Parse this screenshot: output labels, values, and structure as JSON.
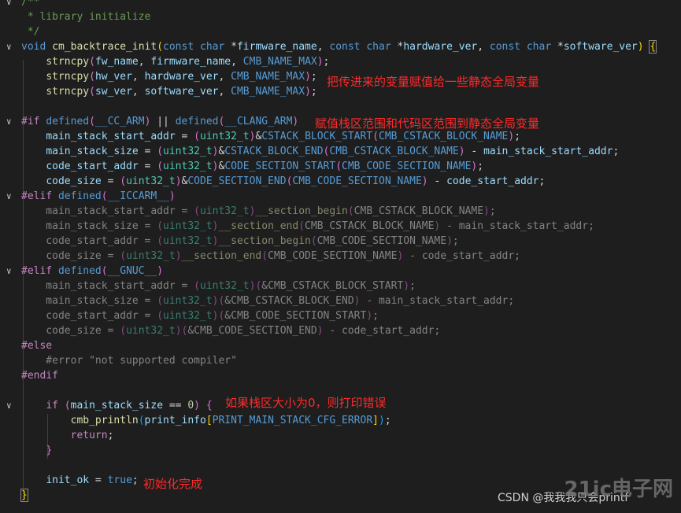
{
  "lines": [
    {
      "fold": "chevron-down",
      "segments": [
        {
          "c": "cm",
          "t": "/**"
        }
      ]
    },
    {
      "fold": "",
      "segments": [
        {
          "c": "cm",
          "t": " * library initialize"
        }
      ]
    },
    {
      "fold": "",
      "segments": [
        {
          "c": "cm",
          "t": " */"
        }
      ]
    },
    {
      "fold": "chevron-down",
      "segments": [
        {
          "c": "kw",
          "t": "void"
        },
        {
          "c": "",
          "t": " "
        },
        {
          "c": "fn",
          "t": "cm_backtrace_init"
        },
        {
          "c": "brace-y",
          "t": "("
        },
        {
          "c": "kw",
          "t": "const"
        },
        {
          "c": "",
          "t": " "
        },
        {
          "c": "kw",
          "t": "char"
        },
        {
          "c": "",
          "t": " *"
        },
        {
          "c": "var",
          "t": "firmware_name"
        },
        {
          "c": "",
          "t": ", "
        },
        {
          "c": "kw",
          "t": "const"
        },
        {
          "c": "",
          "t": " "
        },
        {
          "c": "kw",
          "t": "char"
        },
        {
          "c": "",
          "t": " *"
        },
        {
          "c": "var",
          "t": "hardware_ver"
        },
        {
          "c": "",
          "t": ", "
        },
        {
          "c": "kw",
          "t": "const"
        },
        {
          "c": "",
          "t": " "
        },
        {
          "c": "kw",
          "t": "char"
        },
        {
          "c": "",
          "t": " *"
        },
        {
          "c": "var",
          "t": "software_ver"
        },
        {
          "c": "brace-y",
          "t": ")"
        },
        {
          "c": "",
          "t": " "
        },
        {
          "c": "brace-y brace-hl",
          "t": "{"
        }
      ]
    },
    {
      "fold": "",
      "segments": [
        {
          "c": "",
          "t": "    "
        },
        {
          "c": "fn",
          "t": "strncpy"
        },
        {
          "c": "brace-p",
          "t": "("
        },
        {
          "c": "var",
          "t": "fw_name"
        },
        {
          "c": "",
          "t": ", "
        },
        {
          "c": "var",
          "t": "firmware_name"
        },
        {
          "c": "",
          "t": ", "
        },
        {
          "c": "mac",
          "t": "CMB_NAME_MAX"
        },
        {
          "c": "brace-p",
          "t": ")"
        },
        {
          "c": "",
          "t": ";"
        }
      ]
    },
    {
      "fold": "",
      "segments": [
        {
          "c": "",
          "t": "    "
        },
        {
          "c": "fn",
          "t": "strncpy"
        },
        {
          "c": "brace-p",
          "t": "("
        },
        {
          "c": "var",
          "t": "hw_ver"
        },
        {
          "c": "",
          "t": ", "
        },
        {
          "c": "var",
          "t": "hardware_ver"
        },
        {
          "c": "",
          "t": ", "
        },
        {
          "c": "mac",
          "t": "CMB_NAME_MAX"
        },
        {
          "c": "brace-p",
          "t": ")"
        },
        {
          "c": "",
          "t": ";"
        }
      ]
    },
    {
      "fold": "",
      "segments": [
        {
          "c": "",
          "t": "    "
        },
        {
          "c": "fn",
          "t": "strncpy"
        },
        {
          "c": "brace-p",
          "t": "("
        },
        {
          "c": "var",
          "t": "sw_ver"
        },
        {
          "c": "",
          "t": ", "
        },
        {
          "c": "var",
          "t": "software_ver"
        },
        {
          "c": "",
          "t": ", "
        },
        {
          "c": "mac",
          "t": "CMB_NAME_MAX"
        },
        {
          "c": "brace-p",
          "t": ")"
        },
        {
          "c": "",
          "t": ";"
        }
      ]
    },
    {
      "fold": "",
      "segments": []
    },
    {
      "fold": "chevron-down",
      "segments": [
        {
          "c": "pp",
          "t": "#if"
        },
        {
          "c": "",
          "t": " "
        },
        {
          "c": "kw",
          "t": "defined"
        },
        {
          "c": "brace-p",
          "t": "("
        },
        {
          "c": "mac",
          "t": "__CC_ARM"
        },
        {
          "c": "brace-p",
          "t": ")"
        },
        {
          "c": "",
          "t": " || "
        },
        {
          "c": "kw",
          "t": "defined"
        },
        {
          "c": "brace-p",
          "t": "("
        },
        {
          "c": "mac",
          "t": "__CLANG_ARM"
        },
        {
          "c": "brace-p",
          "t": ")"
        }
      ]
    },
    {
      "fold": "",
      "segments": [
        {
          "c": "",
          "t": "    "
        },
        {
          "c": "var",
          "t": "main_stack_start_addr"
        },
        {
          "c": "",
          "t": " = "
        },
        {
          "c": "brace-p",
          "t": "("
        },
        {
          "c": "ty",
          "t": "uint32_t"
        },
        {
          "c": "brace-p",
          "t": ")"
        },
        {
          "c": "",
          "t": "&"
        },
        {
          "c": "mac",
          "t": "CSTACK_BLOCK_START"
        },
        {
          "c": "brace-p",
          "t": "("
        },
        {
          "c": "mac",
          "t": "CMB_CSTACK_BLOCK_NAME"
        },
        {
          "c": "brace-p",
          "t": ")"
        },
        {
          "c": "",
          "t": ";"
        }
      ]
    },
    {
      "fold": "",
      "segments": [
        {
          "c": "",
          "t": "    "
        },
        {
          "c": "var",
          "t": "main_stack_size"
        },
        {
          "c": "",
          "t": " = "
        },
        {
          "c": "brace-p",
          "t": "("
        },
        {
          "c": "ty",
          "t": "uint32_t"
        },
        {
          "c": "brace-p",
          "t": ")"
        },
        {
          "c": "",
          "t": "&"
        },
        {
          "c": "mac",
          "t": "CSTACK_BLOCK_END"
        },
        {
          "c": "brace-p",
          "t": "("
        },
        {
          "c": "mac",
          "t": "CMB_CSTACK_BLOCK_NAME"
        },
        {
          "c": "brace-p",
          "t": ")"
        },
        {
          "c": "",
          "t": " - "
        },
        {
          "c": "var",
          "t": "main_stack_start_addr"
        },
        {
          "c": "",
          "t": ";"
        }
      ]
    },
    {
      "fold": "",
      "segments": [
        {
          "c": "",
          "t": "    "
        },
        {
          "c": "var",
          "t": "code_start_addr"
        },
        {
          "c": "",
          "t": " = "
        },
        {
          "c": "brace-p",
          "t": "("
        },
        {
          "c": "ty",
          "t": "uint32_t"
        },
        {
          "c": "brace-p",
          "t": ")"
        },
        {
          "c": "",
          "t": "&"
        },
        {
          "c": "mac",
          "t": "CODE_SECTION_START"
        },
        {
          "c": "brace-p",
          "t": "("
        },
        {
          "c": "mac",
          "t": "CMB_CODE_SECTION_NAME"
        },
        {
          "c": "brace-p",
          "t": ")"
        },
        {
          "c": "",
          "t": ";"
        }
      ]
    },
    {
      "fold": "",
      "segments": [
        {
          "c": "",
          "t": "    "
        },
        {
          "c": "var",
          "t": "code_size"
        },
        {
          "c": "",
          "t": " = "
        },
        {
          "c": "brace-p",
          "t": "("
        },
        {
          "c": "ty",
          "t": "uint32_t"
        },
        {
          "c": "brace-p",
          "t": ")"
        },
        {
          "c": "",
          "t": "&"
        },
        {
          "c": "mac",
          "t": "CODE_SECTION_END"
        },
        {
          "c": "brace-p",
          "t": "("
        },
        {
          "c": "mac",
          "t": "CMB_CODE_SECTION_NAME"
        },
        {
          "c": "brace-p",
          "t": ")"
        },
        {
          "c": "",
          "t": " - "
        },
        {
          "c": "var",
          "t": "code_start_addr"
        },
        {
          "c": "",
          "t": ";"
        }
      ]
    },
    {
      "fold": "chevron-down",
      "segments": [
        {
          "c": "pp",
          "t": "#elif"
        },
        {
          "c": "",
          "t": " "
        },
        {
          "c": "kw",
          "t": "defined"
        },
        {
          "c": "brace-p",
          "t": "("
        },
        {
          "c": "mac",
          "t": "__ICCARM__"
        },
        {
          "c": "brace-p",
          "t": ")"
        }
      ]
    },
    {
      "fold": "",
      "inactive": true,
      "segments": [
        {
          "c": "",
          "t": "    main_stack_start_addr = "
        },
        {
          "c": "brace-p",
          "t": "("
        },
        {
          "c": "ty",
          "t": "uint32_t"
        },
        {
          "c": "brace-p",
          "t": ")"
        },
        {
          "c": "fn",
          "t": "__section_begin"
        },
        {
          "c": "brace-p",
          "t": "("
        },
        {
          "c": "",
          "t": "CMB_CSTACK_BLOCK_NAME"
        },
        {
          "c": "brace-p",
          "t": ")"
        },
        {
          "c": "",
          "t": ";"
        }
      ]
    },
    {
      "fold": "",
      "inactive": true,
      "segments": [
        {
          "c": "",
          "t": "    main_stack_size = "
        },
        {
          "c": "brace-p",
          "t": "("
        },
        {
          "c": "ty",
          "t": "uint32_t"
        },
        {
          "c": "brace-p",
          "t": ")"
        },
        {
          "c": "fn",
          "t": "__section_end"
        },
        {
          "c": "brace-p",
          "t": "("
        },
        {
          "c": "",
          "t": "CMB_CSTACK_BLOCK_NAME"
        },
        {
          "c": "brace-p",
          "t": ")"
        },
        {
          "c": "",
          "t": " - main_stack_start_addr;"
        }
      ]
    },
    {
      "fold": "",
      "inactive": true,
      "segments": [
        {
          "c": "",
          "t": "    code_start_addr = "
        },
        {
          "c": "brace-p",
          "t": "("
        },
        {
          "c": "ty",
          "t": "uint32_t"
        },
        {
          "c": "brace-p",
          "t": ")"
        },
        {
          "c": "fn",
          "t": "__section_begin"
        },
        {
          "c": "brace-p",
          "t": "("
        },
        {
          "c": "",
          "t": "CMB_CODE_SECTION_NAME"
        },
        {
          "c": "brace-p",
          "t": ")"
        },
        {
          "c": "",
          "t": ";"
        }
      ]
    },
    {
      "fold": "",
      "inactive": true,
      "segments": [
        {
          "c": "",
          "t": "    code_size = "
        },
        {
          "c": "brace-p",
          "t": "("
        },
        {
          "c": "ty",
          "t": "uint32_t"
        },
        {
          "c": "brace-p",
          "t": ")"
        },
        {
          "c": "fn",
          "t": "__section_end"
        },
        {
          "c": "brace-p",
          "t": "("
        },
        {
          "c": "",
          "t": "CMB_CODE_SECTION_NAME"
        },
        {
          "c": "brace-p",
          "t": ")"
        },
        {
          "c": "",
          "t": " - code_start_addr;"
        }
      ]
    },
    {
      "fold": "chevron-down",
      "segments": [
        {
          "c": "pp",
          "t": "#elif"
        },
        {
          "c": "",
          "t": " "
        },
        {
          "c": "kw",
          "t": "defined"
        },
        {
          "c": "brace-p",
          "t": "("
        },
        {
          "c": "mac",
          "t": "__GNUC__"
        },
        {
          "c": "brace-p",
          "t": ")"
        }
      ]
    },
    {
      "fold": "",
      "inactive": true,
      "segments": [
        {
          "c": "",
          "t": "    main_stack_start_addr = "
        },
        {
          "c": "brace-p",
          "t": "("
        },
        {
          "c": "ty",
          "t": "uint32_t"
        },
        {
          "c": "brace-p",
          "t": ")"
        },
        {
          "c": "brace-p",
          "t": "("
        },
        {
          "c": "",
          "t": "&CMB_CSTACK_BLOCK_START"
        },
        {
          "c": "brace-p",
          "t": ")"
        },
        {
          "c": "",
          "t": ";"
        }
      ]
    },
    {
      "fold": "",
      "inactive": true,
      "segments": [
        {
          "c": "",
          "t": "    main_stack_size = "
        },
        {
          "c": "brace-p",
          "t": "("
        },
        {
          "c": "ty",
          "t": "uint32_t"
        },
        {
          "c": "brace-p",
          "t": ")"
        },
        {
          "c": "brace-p",
          "t": "("
        },
        {
          "c": "",
          "t": "&CMB_CSTACK_BLOCK_END"
        },
        {
          "c": "brace-p",
          "t": ")"
        },
        {
          "c": "",
          "t": " - main_stack_start_addr;"
        }
      ]
    },
    {
      "fold": "",
      "inactive": true,
      "segments": [
        {
          "c": "",
          "t": "    code_start_addr = "
        },
        {
          "c": "brace-p",
          "t": "("
        },
        {
          "c": "ty",
          "t": "uint32_t"
        },
        {
          "c": "brace-p",
          "t": ")"
        },
        {
          "c": "brace-p",
          "t": "("
        },
        {
          "c": "",
          "t": "&CMB_CODE_SECTION_START"
        },
        {
          "c": "brace-p",
          "t": ")"
        },
        {
          "c": "",
          "t": ";"
        }
      ]
    },
    {
      "fold": "",
      "inactive": true,
      "segments": [
        {
          "c": "",
          "t": "    code_size = "
        },
        {
          "c": "brace-p",
          "t": "("
        },
        {
          "c": "ty",
          "t": "uint32_t"
        },
        {
          "c": "brace-p",
          "t": ")"
        },
        {
          "c": "brace-p",
          "t": "("
        },
        {
          "c": "",
          "t": "&CMB_CODE_SECTION_END"
        },
        {
          "c": "brace-p",
          "t": ")"
        },
        {
          "c": "",
          "t": " - code_start_addr;"
        }
      ]
    },
    {
      "fold": "",
      "segments": [
        {
          "c": "pp",
          "t": "#else"
        }
      ]
    },
    {
      "fold": "",
      "inactive": true,
      "segments": [
        {
          "c": "",
          "t": "    #error \"not supported compiler\""
        }
      ]
    },
    {
      "fold": "",
      "segments": [
        {
          "c": "pp",
          "t": "#endif"
        }
      ]
    },
    {
      "fold": "",
      "segments": []
    },
    {
      "fold": "chevron-down",
      "segments": [
        {
          "c": "",
          "t": "    "
        },
        {
          "c": "ctl",
          "t": "if"
        },
        {
          "c": "",
          "t": " "
        },
        {
          "c": "brace-p",
          "t": "("
        },
        {
          "c": "var",
          "t": "main_stack_size"
        },
        {
          "c": "",
          "t": " == "
        },
        {
          "c": "num",
          "t": "0"
        },
        {
          "c": "brace-p",
          "t": ")"
        },
        {
          "c": "",
          "t": " "
        },
        {
          "c": "brace-p",
          "t": "{"
        }
      ]
    },
    {
      "fold": "",
      "segments": [
        {
          "c": "",
          "t": "        "
        },
        {
          "c": "fn",
          "t": "cmb_println"
        },
        {
          "c": "brace-b",
          "t": "("
        },
        {
          "c": "var",
          "t": "print_info"
        },
        {
          "c": "brace-y",
          "t": "["
        },
        {
          "c": "mac",
          "t": "PRINT_MAIN_STACK_CFG_ERROR"
        },
        {
          "c": "brace-y",
          "t": "]"
        },
        {
          "c": "brace-b",
          "t": ")"
        },
        {
          "c": "",
          "t": ";"
        }
      ]
    },
    {
      "fold": "",
      "segments": [
        {
          "c": "",
          "t": "        "
        },
        {
          "c": "ctl",
          "t": "return"
        },
        {
          "c": "",
          "t": ";"
        }
      ]
    },
    {
      "fold": "",
      "segments": [
        {
          "c": "",
          "t": "    "
        },
        {
          "c": "brace-p",
          "t": "}"
        }
      ]
    },
    {
      "fold": "",
      "segments": []
    },
    {
      "fold": "",
      "segments": [
        {
          "c": "",
          "t": "    "
        },
        {
          "c": "var",
          "t": "init_ok"
        },
        {
          "c": "",
          "t": " = "
        },
        {
          "c": "kw",
          "t": "true"
        },
        {
          "c": "",
          "t": ";"
        }
      ]
    },
    {
      "fold": "",
      "segments": [
        {
          "c": "brace-y brace-hl",
          "t": "}"
        }
      ]
    }
  ],
  "annotations": {
    "a1": "把传进来的变量赋值给一些静态全局变量",
    "a2": "赋值栈区范围和代码区范围到静态全局变量",
    "a3": "如果栈区大小为0，则打印错误",
    "a4": "初始化完成"
  },
  "watermark": {
    "csdn": "CSDN @我我我只会printf",
    "logo": "21ic电子网"
  }
}
